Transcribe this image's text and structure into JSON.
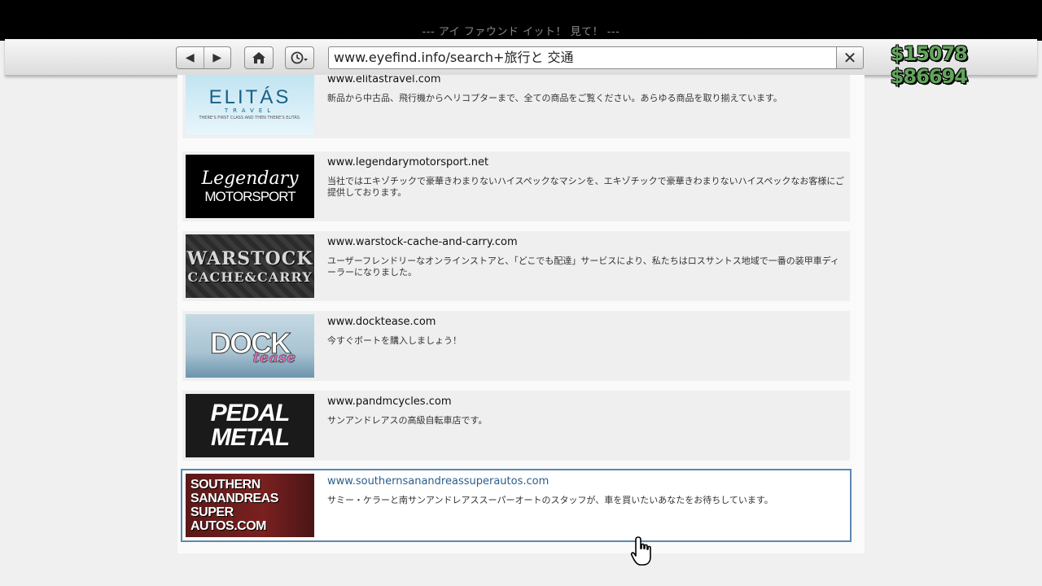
{
  "window": {
    "title": "--- アイ ファウンド イット！ 見て！ ---"
  },
  "toolbar": {
    "back_icon": "◀",
    "forward_icon": "▶",
    "url": "www.eyefind.info/search+旅行と 交通",
    "clear_icon": "✕"
  },
  "hud": {
    "cash": "$15078",
    "bank": "$86694"
  },
  "results": [
    {
      "url": "www.elitastravel.com",
      "description": "新品から中古品、飛行機からヘリコプターまで、全ての商品をご覧ください。あらゆる商品を取り揃えています。",
      "logo": {
        "line1": "ELITÁS",
        "line2": "TRAVEL",
        "line3": "THERE'S FIRST CLASS AND THEN THERE'S ELITÁS."
      }
    },
    {
      "url": "www.legendarymotorsport.net",
      "description": "当社ではエキゾチックで豪華きわまりないハイスペックなマシンを、エキゾチックで豪華きわまりないハイスペックなお客様にご提供しております。",
      "logo": {
        "line1": "Legendary",
        "line2": "MOTORSPORT"
      }
    },
    {
      "url": "www.warstock-cache-and-carry.com",
      "description": "ユーザーフレンドリーなオンラインストアと、「どこでも配達」サービスにより、私たちはロスサントス地域で一番の装甲車ディーラーになりました。",
      "logo": {
        "line1": "WARSTOCK",
        "line2": "CACHE&CARRY"
      }
    },
    {
      "url": "www.docktease.com",
      "description": "今すぐボートを購入しましょう！",
      "logo": {
        "line1": "DOCK",
        "line2": "tease"
      }
    },
    {
      "url": "www.pandmcycles.com",
      "description": "サンアンドレアスの高級自転車店です。",
      "logo": {
        "line1": "PEDAL",
        "line2": "METAL"
      }
    },
    {
      "url": "www.southernsanandreassuperautos.com",
      "description": "サミー・ケラーと南サンアンドレアススーパーオートのスタッフが、車を買いたいあなたをお待ちしています。",
      "logo": {
        "line1": "SOUTHERN",
        "line2": "SANANDREAS",
        "line3": "SUPER",
        "line4": "AUTOS.COM"
      }
    }
  ]
}
